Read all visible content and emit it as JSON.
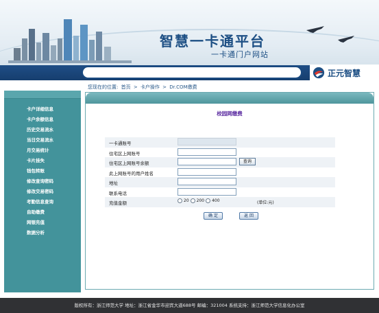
{
  "header": {
    "title": "智慧一卡通平台",
    "subtitle": "一卡通门户网站",
    "brand": "正元智慧",
    "search_value": ""
  },
  "breadcrumb": {
    "prefix": "您现在的位置:",
    "items": [
      "首页",
      "卡户操作",
      "Dr.COM缴费"
    ],
    "separator": ">"
  },
  "sidebar": {
    "items": [
      {
        "label": "卡户详细信息"
      },
      {
        "label": "卡户余额信息"
      },
      {
        "label": "历史交易流水"
      },
      {
        "label": "当日交易流水"
      },
      {
        "label": "月交易统计"
      },
      {
        "label": "卡片挂失"
      },
      {
        "label": "钱包转账"
      },
      {
        "label": "修改查询密码"
      },
      {
        "label": "修改交易密码"
      },
      {
        "label": "考勤信息查询"
      },
      {
        "label": "自助缴费"
      },
      {
        "label": "网银充值"
      },
      {
        "label": "数据分析"
      }
    ]
  },
  "panel": {
    "title": "校园网缴费",
    "fields": [
      {
        "label": "一卡通账号",
        "value": ""
      },
      {
        "label": "住宅区上网账号",
        "value": ""
      },
      {
        "label": "住宅区上网账号余额",
        "value": ""
      },
      {
        "label": "此上网账号的用户姓名",
        "value": ""
      },
      {
        "label": "地址",
        "value": ""
      },
      {
        "label": "联系电话",
        "value": ""
      },
      {
        "label": "充值金额"
      }
    ],
    "query_button": "查询",
    "amount_options": [
      "20",
      "200",
      "400"
    ],
    "unit": "(单位:元)",
    "confirm_button": "确 定",
    "back_button": "返 回"
  },
  "footer": {
    "text": "版权所有：浙江师范大学  地址：浙江省金华市迎宾大道688号  邮编：321004  系统支持：浙江师范大学信息化办公室"
  },
  "colors": {
    "brand_blue": "#1d4f84",
    "sidebar_teal": "#43939b",
    "title_purple": "#5a2aa0",
    "footer_dark": "#303134"
  }
}
